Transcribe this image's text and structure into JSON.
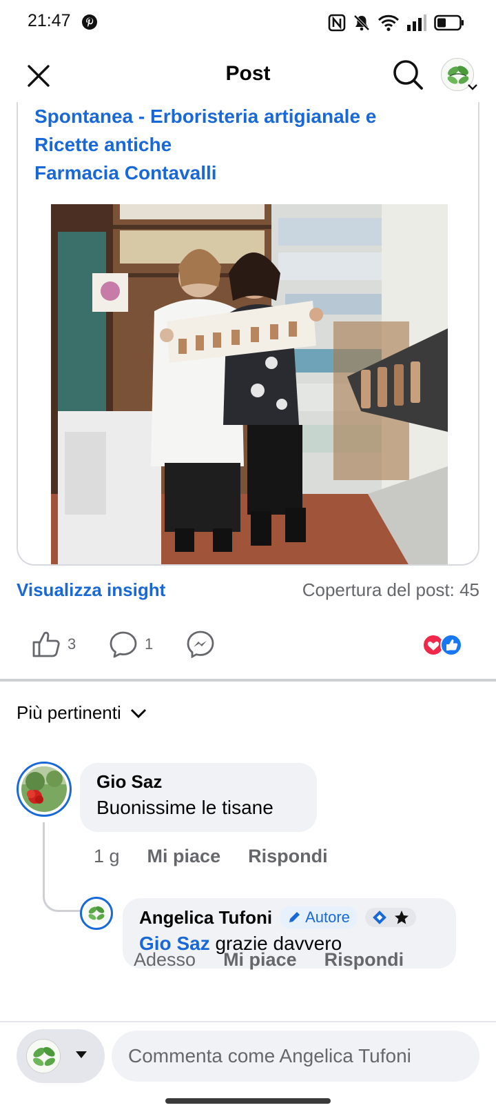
{
  "status_bar": {
    "time": "21:47",
    "app_icon": "pinterest-icon",
    "icons": [
      "nfc-icon",
      "mute-icon",
      "wifi-icon",
      "signal-icon",
      "battery-icon"
    ]
  },
  "nav": {
    "title": "Post",
    "close_icon": "close-icon",
    "search_icon": "search-icon"
  },
  "post": {
    "title_lines": [
      "Spontanea -  Erboristeria artigianale e",
      "Ricette antiche",
      "Farmacia Contavalli"
    ]
  },
  "insights": {
    "link_label": "Visualizza insight",
    "reach_label": "Copertura del post: 45"
  },
  "actions": {
    "likes": "3",
    "comments": "1"
  },
  "colors": {
    "accent": "#1868d8",
    "heart": "#f02849",
    "secondary_text": "#65676b",
    "bubble": "#f0f2f5"
  },
  "sort": {
    "label": "Più pertinenti"
  },
  "comments": [
    {
      "author": "Gio Saz",
      "text": "Buonissime le tisane",
      "time": "1 g",
      "like_label": "Mi piace",
      "reply_label": "Rispondi"
    },
    {
      "author": "Angelica Tufoni",
      "badge": "Autore",
      "mention": "Gio Saz",
      "text": "grazie davvero",
      "time": "Adesso",
      "like_label": "Mi piace",
      "reply_label": "Rispondi"
    }
  ],
  "composer": {
    "placeholder": "Commenta come Angelica Tufoni"
  }
}
